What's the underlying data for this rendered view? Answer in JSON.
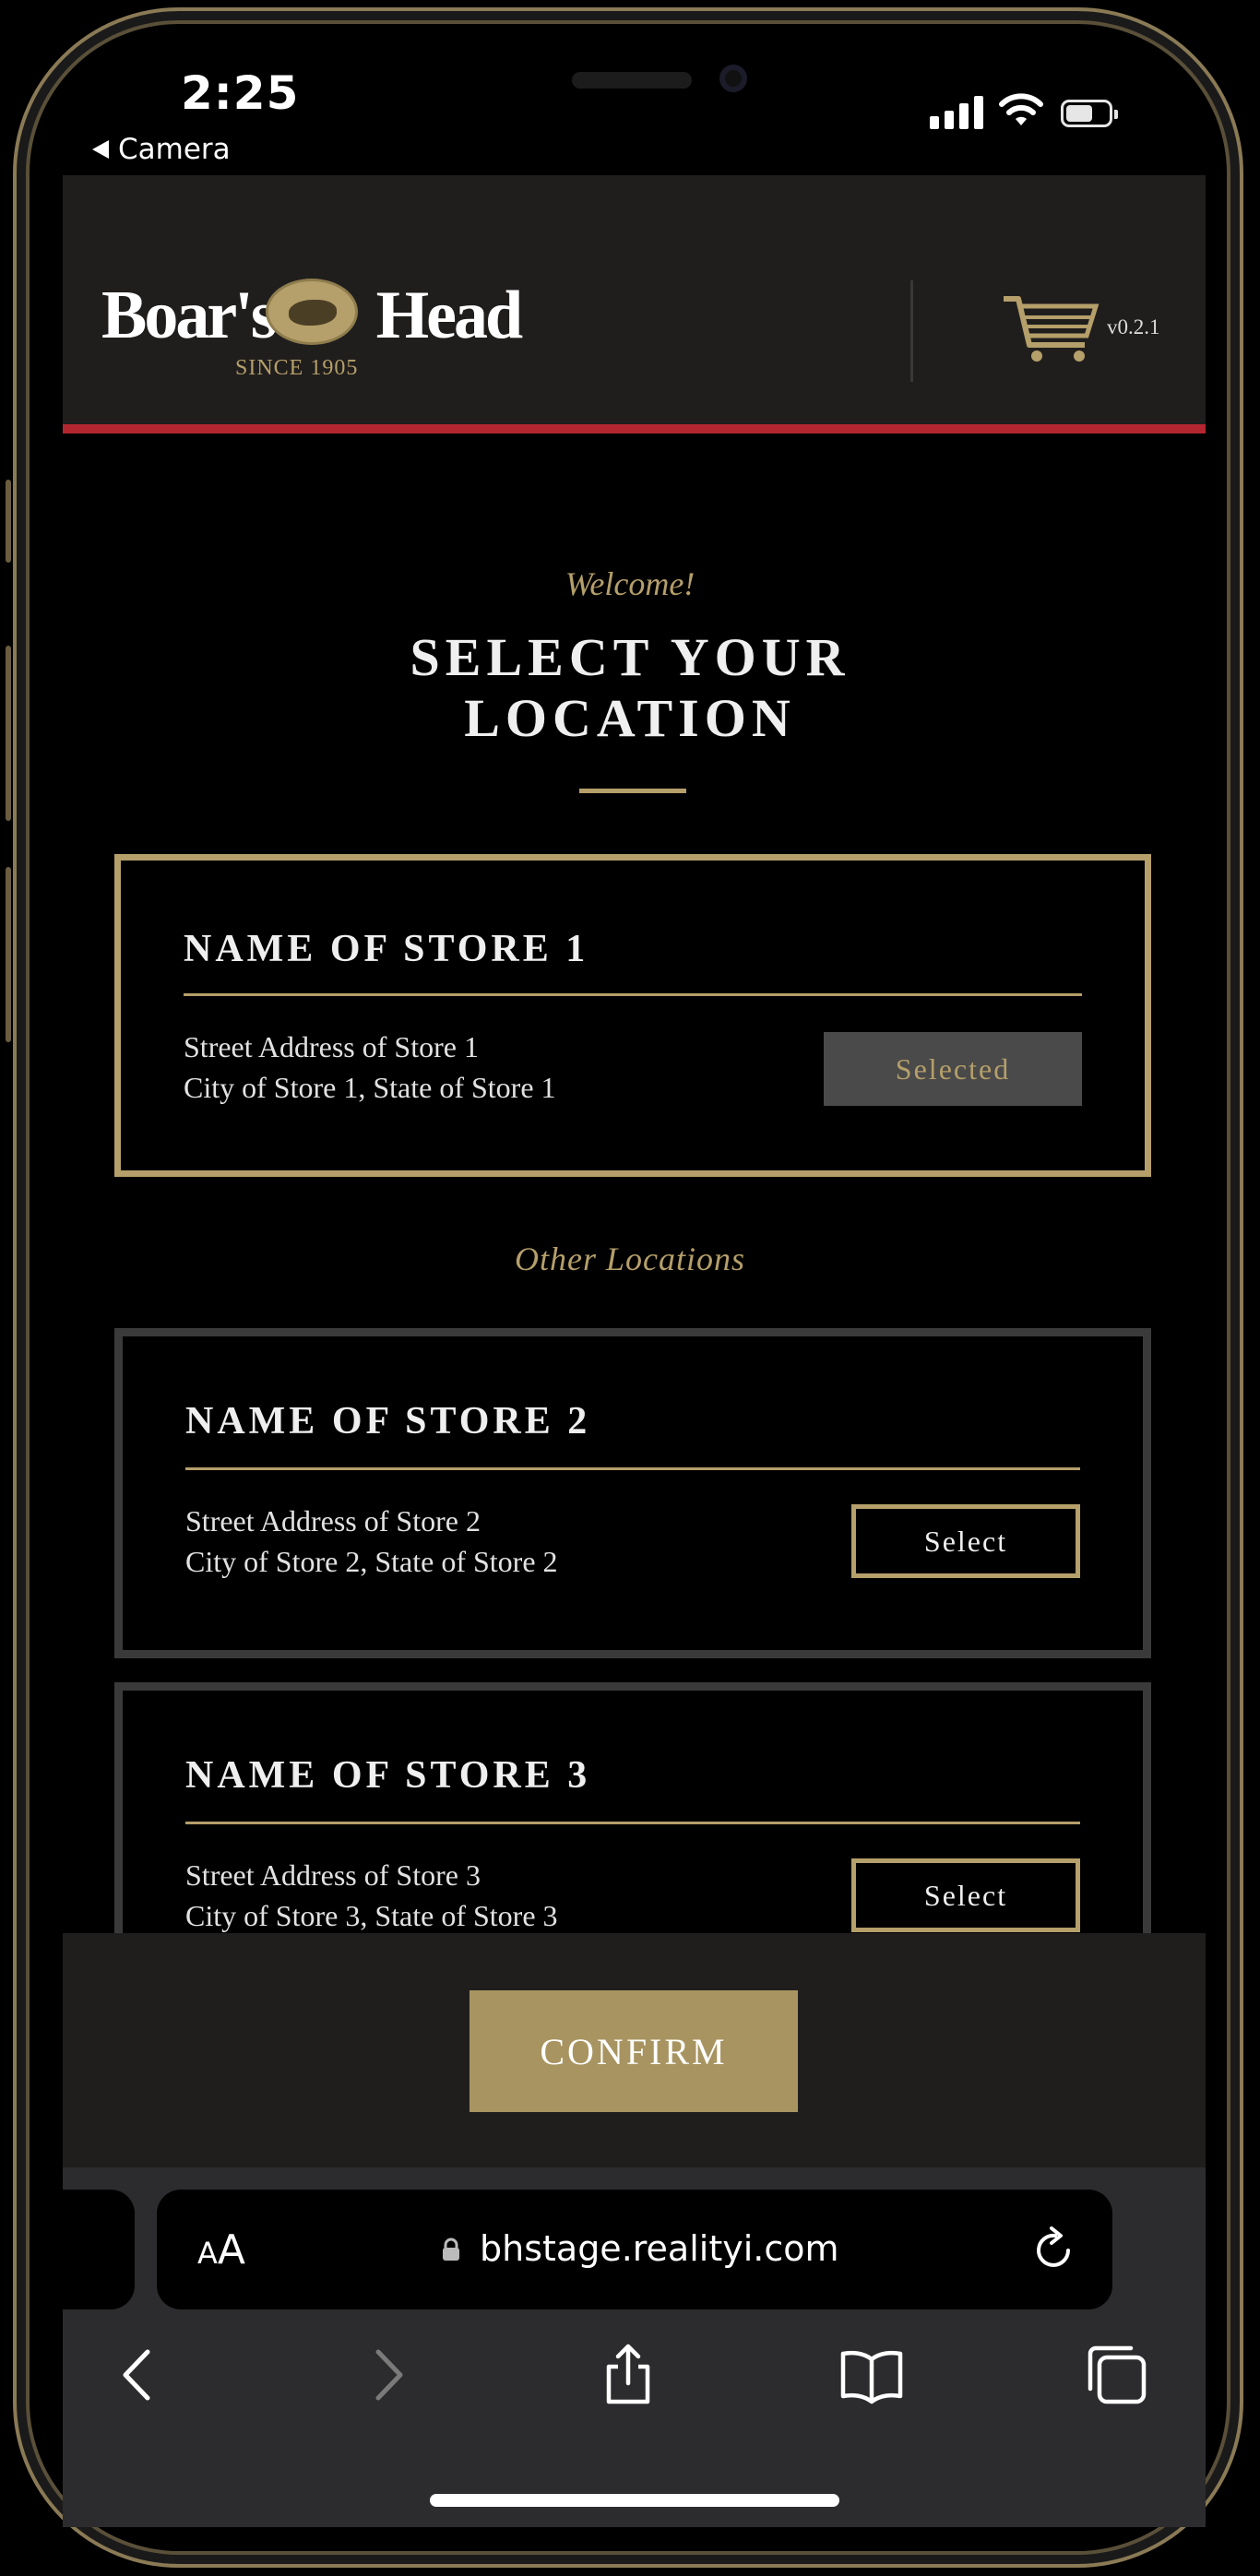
{
  "status_bar": {
    "time": "2:25",
    "back_label": "Camera"
  },
  "header": {
    "logo_word_1": "Boar's",
    "logo_word_2": "Head",
    "logo_tagline": "SINCE 1905",
    "version": "v0.2.1",
    "accent_color": "#b3262f"
  },
  "main": {
    "welcome": "Welcome!",
    "title_line_1": "SELECT YOUR",
    "title_line_2": "LOCATION",
    "other_locations_label": "Other Locations"
  },
  "stores": [
    {
      "name": "NAME OF STORE 1",
      "address_line_1": "Street Address of Store 1",
      "address_line_2": "City of Store 1, State of Store 1",
      "button_label": "Selected",
      "selected": true
    },
    {
      "name": "NAME OF STORE 2",
      "address_line_1": "Street Address of Store 2",
      "address_line_2": "City of Store 2, State of Store 2",
      "button_label": "Select",
      "selected": false
    },
    {
      "name": "NAME OF STORE 3",
      "address_line_1": "Street Address of Store 3",
      "address_line_2": "City of Store 3, State of Store 3",
      "button_label": "Select",
      "selected": false
    }
  ],
  "footer": {
    "confirm_label": "CONFIRM",
    "gold_color": "#a89460"
  },
  "safari": {
    "text_size_label": "AA",
    "url": "bhstage.realityi.com",
    "icons": [
      "back-icon",
      "forward-icon",
      "share-icon",
      "bookmarks-icon",
      "tabs-icon",
      "reload-icon",
      "lock-icon"
    ]
  }
}
